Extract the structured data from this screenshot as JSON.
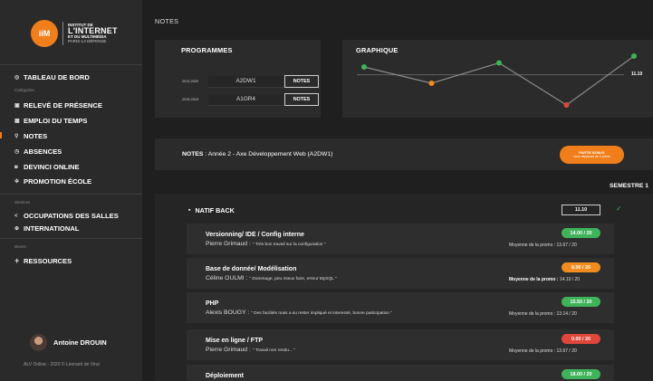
{
  "logo": {
    "abbr": "iiM",
    "line1": "INSTITUT DE",
    "line2": "L'INTERNET",
    "line3": "ET DU MULTIMÉDIA",
    "line4": "PARIS-LA DÉFENSE"
  },
  "sidebar": {
    "main": {
      "icon": "dashboard-icon",
      "label": "TABLEAU DE BORD"
    },
    "categories_label": "Catégories",
    "categories": [
      {
        "icon": "presence-icon",
        "label": "RELEVÉ DE PRÉSENCE"
      },
      {
        "icon": "calendar-icon",
        "label": "EMPLOI DU TEMPS"
      },
      {
        "icon": "grades-icon",
        "label": "NOTES",
        "active": true
      },
      {
        "icon": "clock-icon",
        "label": "ABSENCES"
      },
      {
        "icon": "user-icon",
        "label": "DEVINCI ONLINE"
      },
      {
        "icon": "star-icon",
        "label": "PROMOTION ÉCOLE"
      }
    ],
    "services_label": "Services",
    "services": [
      {
        "icon": "share-icon",
        "label": "OCCUPATIONS DES SALLES"
      },
      {
        "icon": "globe-icon",
        "label": "INTERNATIONAL"
      }
    ],
    "divers_label": "Divers",
    "divers": [
      {
        "icon": "plus-icon",
        "label": "RESSOURCES"
      }
    ]
  },
  "user": {
    "name": "Antoine DROUIN"
  },
  "footer": "ALV Online - 2020 © Léonard de Vinci",
  "page_title": "NOTES",
  "programmes": {
    "title": "PROGRAMMES",
    "rows": [
      {
        "year": "2019-2020",
        "code": "A2DW1",
        "button": "NOTES"
      },
      {
        "year": "2018-2019",
        "code": "A1GR4",
        "button": "NOTES"
      }
    ]
  },
  "graphique": {
    "title": "GRAPHIQUE",
    "value_label": "11.10"
  },
  "chart_data": {
    "type": "line",
    "title": "GRAPHIQUE",
    "values": [
      14.0,
      8.0,
      15.5,
      0.0,
      18.0
    ],
    "point_colors": [
      "#3fb35a",
      "#f28c1e",
      "#3fb35a",
      "#e0463a",
      "#3fb35a"
    ],
    "reference_line": 11.1,
    "reference_label": "11.10",
    "ylim": [
      0,
      20
    ],
    "grid": false
  },
  "notes_bar": {
    "label": "NOTES",
    "text": " : Année 2 - Axe Développement Web (A2DW1)",
    "bonus_line1": "PARTIE BONUS",
    "bonus_line2": "Vous dépassez de 5 points"
  },
  "semestre": "SEMESTRE 1",
  "section": {
    "icon": "save-icon",
    "title": "NATIF BACK",
    "average": "11.10"
  },
  "courses": [
    {
      "title": "Versionning/ IDE / Config interne",
      "teacher": "Pierre Grimaud",
      "comment": "Très bon travail sur la configuration",
      "grade": "14.00 / 20",
      "grade_color": "#3fb35a",
      "promo_label": "Moyenne de la promo :",
      "promo_value": "13.67 / 20",
      "promo_bold": false
    },
    {
      "title": "Base de donnée/ Modélisation",
      "teacher": "Céline OULMI",
      "comment": "Dommage, peu mieux faire, erreur MySQL",
      "grade": "8.00 / 20",
      "grade_color": "#f28c1e",
      "promo_label": "Moyenne de la promo :",
      "promo_value": "14.10 / 20",
      "promo_bold": true
    },
    {
      "title": "PHP",
      "teacher": "Alexis BOUGY",
      "comment": "Des facilités mais a su rester impliqué et interessé, bonne participation",
      "grade": "15.50 / 20",
      "grade_color": "#3fb35a",
      "promo_label": "Moyenne de la promo :",
      "promo_value": "13.14 / 20",
      "promo_bold": false
    },
    {
      "title": "Mise en ligne / FTP",
      "teacher": "Pierre Grimaud",
      "comment": "Travail non rendu...",
      "grade": "0.00 / 20",
      "grade_color": "#e0463a",
      "promo_label": "Moyenne de la promo :",
      "promo_value": "13.67 / 20",
      "promo_bold": false
    },
    {
      "title": "Déploiement",
      "teacher": "",
      "comment": "",
      "grade": "18.00 / 20",
      "grade_color": "#3fb35a",
      "promo_label": "",
      "promo_value": "",
      "promo_bold": false
    }
  ]
}
